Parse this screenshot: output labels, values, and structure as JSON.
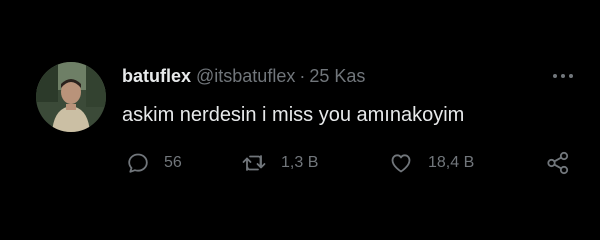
{
  "tweet": {
    "display_name": "batuflex",
    "handle": "@itsbatuflex",
    "separator": "·",
    "date": "25 Kas",
    "text": "askim nerdesin i miss you amınakoyim",
    "replies": "56",
    "retweets": "1,3 B",
    "likes": "18,4 B"
  },
  "icons": {
    "more": "more-horizontal-icon",
    "reply": "reply-icon",
    "retweet": "retweet-icon",
    "like": "heart-icon",
    "share": "share-icon"
  },
  "colors": {
    "background": "#000000",
    "primary_text": "#e7e9ea",
    "secondary_text": "#71767b"
  }
}
